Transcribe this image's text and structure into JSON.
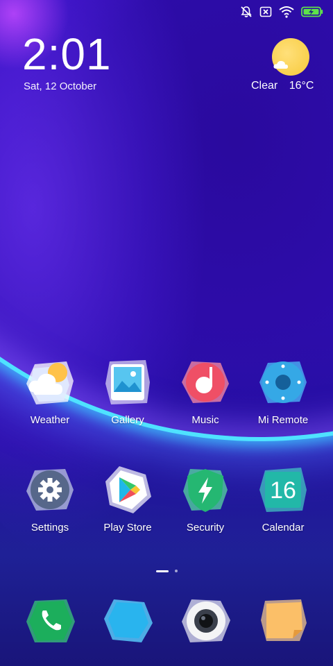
{
  "status_bar": {
    "icons": [
      "bell-off-icon",
      "no-sim-icon",
      "wifi-icon",
      "battery-charging-icon"
    ]
  },
  "clock": {
    "time": "2:01",
    "date": "Sat, 12 October"
  },
  "weather_widget": {
    "condition": "Clear",
    "temperature": "16°C",
    "icon": "sun-cloud-icon"
  },
  "home_grid": [
    {
      "label": "Weather",
      "icon": "weather-app-icon"
    },
    {
      "label": "Gallery",
      "icon": "gallery-app-icon"
    },
    {
      "label": "Music",
      "icon": "music-app-icon"
    },
    {
      "label": "Mi Remote",
      "icon": "remote-app-icon"
    },
    {
      "label": "Settings",
      "icon": "settings-app-icon"
    },
    {
      "label": "Play Store",
      "icon": "play-store-app-icon"
    },
    {
      "label": "Security",
      "icon": "security-app-icon"
    },
    {
      "label": "Calendar",
      "icon": "calendar-app-icon",
      "badge_text": "16"
    }
  ],
  "page_indicator": {
    "pages": 2,
    "current": 1
  },
  "dock": [
    {
      "icon": "phone-app-icon"
    },
    {
      "icon": "messages-app-icon"
    },
    {
      "icon": "camera-app-icon"
    },
    {
      "icon": "notes-app-icon"
    }
  ],
  "colors": {
    "wifi_white": "#ffffff",
    "battery_green": "#5ee24a",
    "accent_cyan": "#4fe3ff"
  }
}
